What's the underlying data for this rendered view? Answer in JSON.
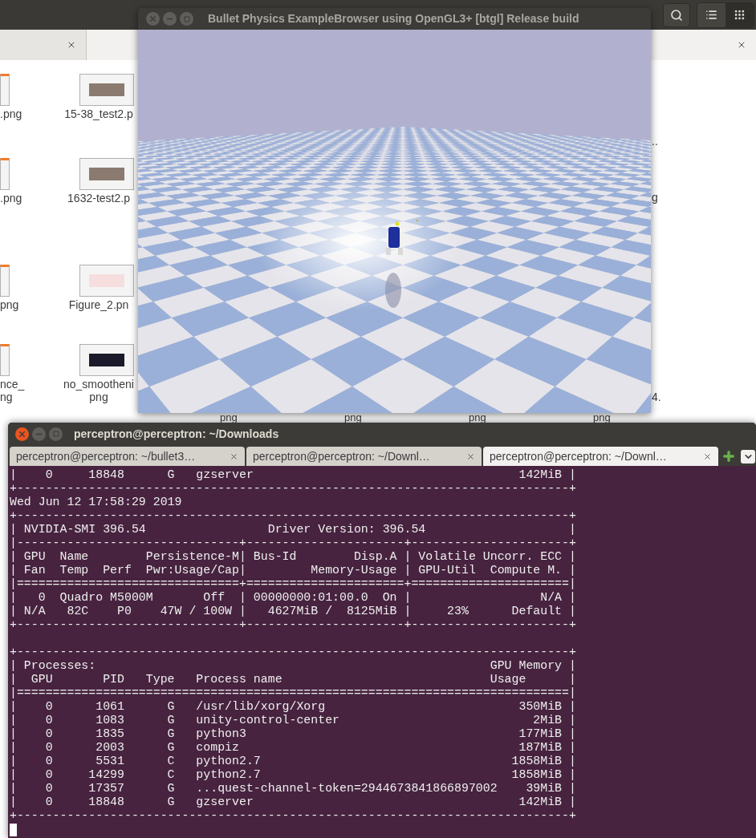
{
  "file_manager": {
    "view_buttons": [
      {
        "selected": false
      },
      {
        "selected": true
      }
    ],
    "left_column": [
      {
        "label_lines": [
          ".png"
        ]
      },
      {
        "label_lines": [
          ".png"
        ]
      },
      {
        "label_lines": [
          "png"
        ]
      },
      {
        "label_lines": [
          "nce_",
          "ng"
        ]
      }
    ],
    "second_column": [
      {
        "label_lines": [
          "15-38_test2.p"
        ]
      },
      {
        "label_lines": [
          "1632-test2.p"
        ]
      },
      {
        "label_lines": [
          "Figure_2.pn"
        ]
      },
      {
        "label_lines": [
          "no_smootheni",
          "png"
        ]
      }
    ],
    "right_column": [
      {
        "label": ".."
      },
      {
        "label": "g"
      },
      {
        "label": "4."
      }
    ],
    "bottom_row": [
      {
        "label": "png"
      },
      {
        "label": "png"
      },
      {
        "label": "png"
      },
      {
        "label": "png"
      }
    ]
  },
  "gl_window": {
    "title": "Bullet Physics ExampleBrowser using OpenGL3+ [btgl] Release build"
  },
  "terminal": {
    "title": "perceptron@perceptron: ~/Downloads",
    "tabs": [
      {
        "label": "perceptron@perceptron: ~/bullet3…",
        "selected": false
      },
      {
        "label": "perceptron@perceptron: ~/Downl…",
        "selected": false
      },
      {
        "label": "perceptron@perceptron: ~/Downl…",
        "selected": true
      }
    ],
    "blocks": [
      [
        "|    0     18848      G   gzserver                                     142MiB |",
        "+-----------------------------------------------------------------------------+",
        "Wed Jun 12 17:58:29 2019",
        "+-----------------------------------------------------------------------------+",
        "| NVIDIA-SMI 396.54                 Driver Version: 396.54                    |",
        "|-------------------------------+----------------------+----------------------+",
        "| GPU  Name        Persistence-M| Bus-Id        Disp.A | Volatile Uncorr. ECC |",
        "| Fan  Temp  Perf  Pwr:Usage/Cap|         Memory-Usage | GPU-Util  Compute M. |",
        "|===============================+======================+======================|",
        "|   0  Quadro M5000M       Off  | 00000000:01:00.0  On |                  N/A |",
        "| N/A   82C    P0    47W / 100W |   4627MiB /  8125MiB |     23%      Default |",
        "+-------------------------------+----------------------+----------------------+"
      ],
      [
        "+-----------------------------------------------------------------------------+",
        "| Processes:                                                       GPU Memory |",
        "|  GPU       PID   Type   Process name                             Usage      |",
        "|=============================================================================|",
        "|    0      1061      G   /usr/lib/xorg/Xorg                           350MiB |",
        "|    0      1083      G   unity-control-center                           2MiB |",
        "|    0      1835      G   python3                                      177MiB |",
        "|    0      2003      G   compiz                                       187MiB |",
        "|    0      5531      C   python2.7                                   1858MiB |",
        "|    0     14299      C   python2.7                                   1858MiB |",
        "|    0     17357      G   ...quest-channel-token=2944673841866897002    39MiB |",
        "|    0     18848      G   gzserver                                     142MiB |",
        "+-----------------------------------------------------------------------------+"
      ]
    ]
  }
}
